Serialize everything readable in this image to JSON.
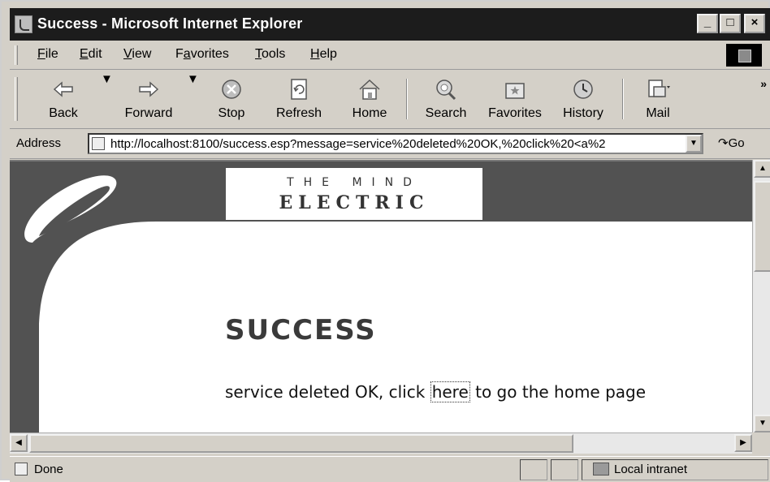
{
  "window": {
    "title": "Success - Microsoft Internet Explorer",
    "buttons": {
      "minimize": "_",
      "maximize": "□",
      "close": "×"
    }
  },
  "menu": [
    {
      "label_ul": "F",
      "label_rest": "ile"
    },
    {
      "label_ul": "E",
      "label_rest": "dit"
    },
    {
      "label_ul": "V",
      "label_rest": "iew"
    },
    {
      "label_pre": "F",
      "label_ul": "a",
      "label_rest": "vorites"
    },
    {
      "label_ul": "T",
      "label_rest": "ools"
    },
    {
      "label_ul": "H",
      "label_rest": "elp"
    }
  ],
  "toolbar": {
    "back": "Back",
    "forward": "Forward",
    "stop": "Stop",
    "refresh": "Refresh",
    "home": "Home",
    "search": "Search",
    "favorites": "Favorites",
    "history": "History",
    "mail": "Mail",
    "more": "»"
  },
  "address": {
    "label": "Address",
    "url": "http://localhost:8100/success.esp?message=service%20deleted%20OK,%20click%20<a%2",
    "go": "Go"
  },
  "page": {
    "brand_top": "THE MIND",
    "brand_bottom": "ELECTRIC",
    "heading": "SUCCESS",
    "message_before": "service deleted OK, click ",
    "message_link": "here",
    "message_after": " to go the home page"
  },
  "status": {
    "text": "Done",
    "zone": "Local intranet"
  }
}
